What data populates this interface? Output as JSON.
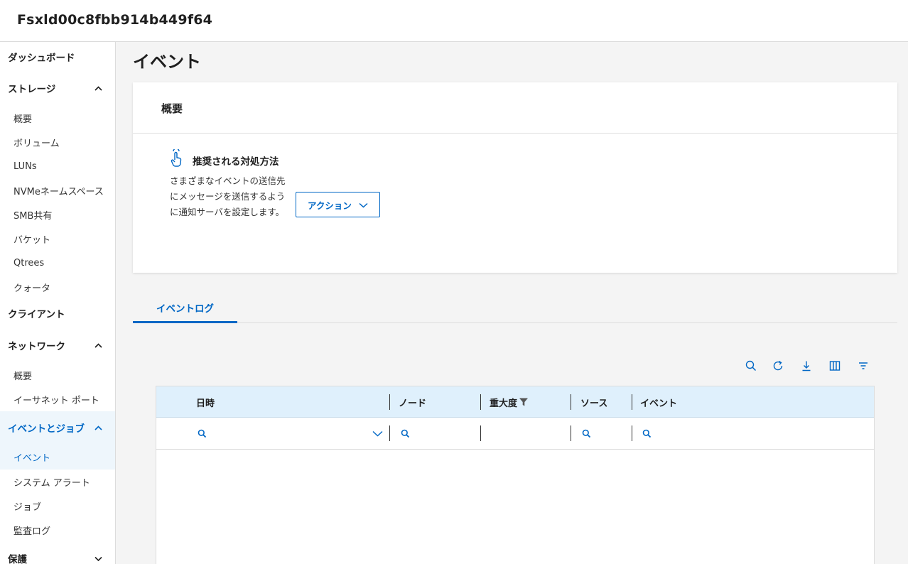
{
  "app": {
    "title": "Fsxld00c8fbb914b449f64"
  },
  "sidebar": {
    "dashboard": "ダッシュボード",
    "storage": {
      "label": "ストレージ",
      "items": [
        "概要",
        "ボリューム",
        "LUNs",
        "NVMeネームスペース",
        "SMB共有",
        "バケット",
        "Qtrees",
        "クォータ"
      ]
    },
    "clients": "クライアント",
    "network": {
      "label": "ネットワーク",
      "items": [
        "概要",
        "イーサネット ポート"
      ]
    },
    "events_jobs": {
      "label": "イベントとジョブ",
      "items": [
        "イベント",
        "システム アラート",
        "ジョブ",
        "監査ログ"
      ]
    },
    "protection": "保護"
  },
  "main": {
    "page_title": "イベント",
    "overview": {
      "heading": "概要",
      "recommendation_title": "推奨される対処方法",
      "recommendation_text": "さまざまなイベントの送信先にメッセージを送信するように通知サーバを設定します。",
      "action_button": "アクション"
    },
    "tabs": [
      "イベントログ"
    ],
    "table": {
      "columns": [
        "日時",
        "ノード",
        "重大度",
        "ソース",
        "イベント"
      ]
    }
  },
  "colors": {
    "accent": "#0067c5",
    "header_bg": "#dff0fc",
    "active_bg": "#eef6fc"
  },
  "icons": [
    "search-icon",
    "refresh-icon",
    "download-icon",
    "columns-icon",
    "filter-icon",
    "hand-pointer-icon",
    "funnel-icon",
    "chevron-up-icon",
    "chevron-down-icon"
  ]
}
